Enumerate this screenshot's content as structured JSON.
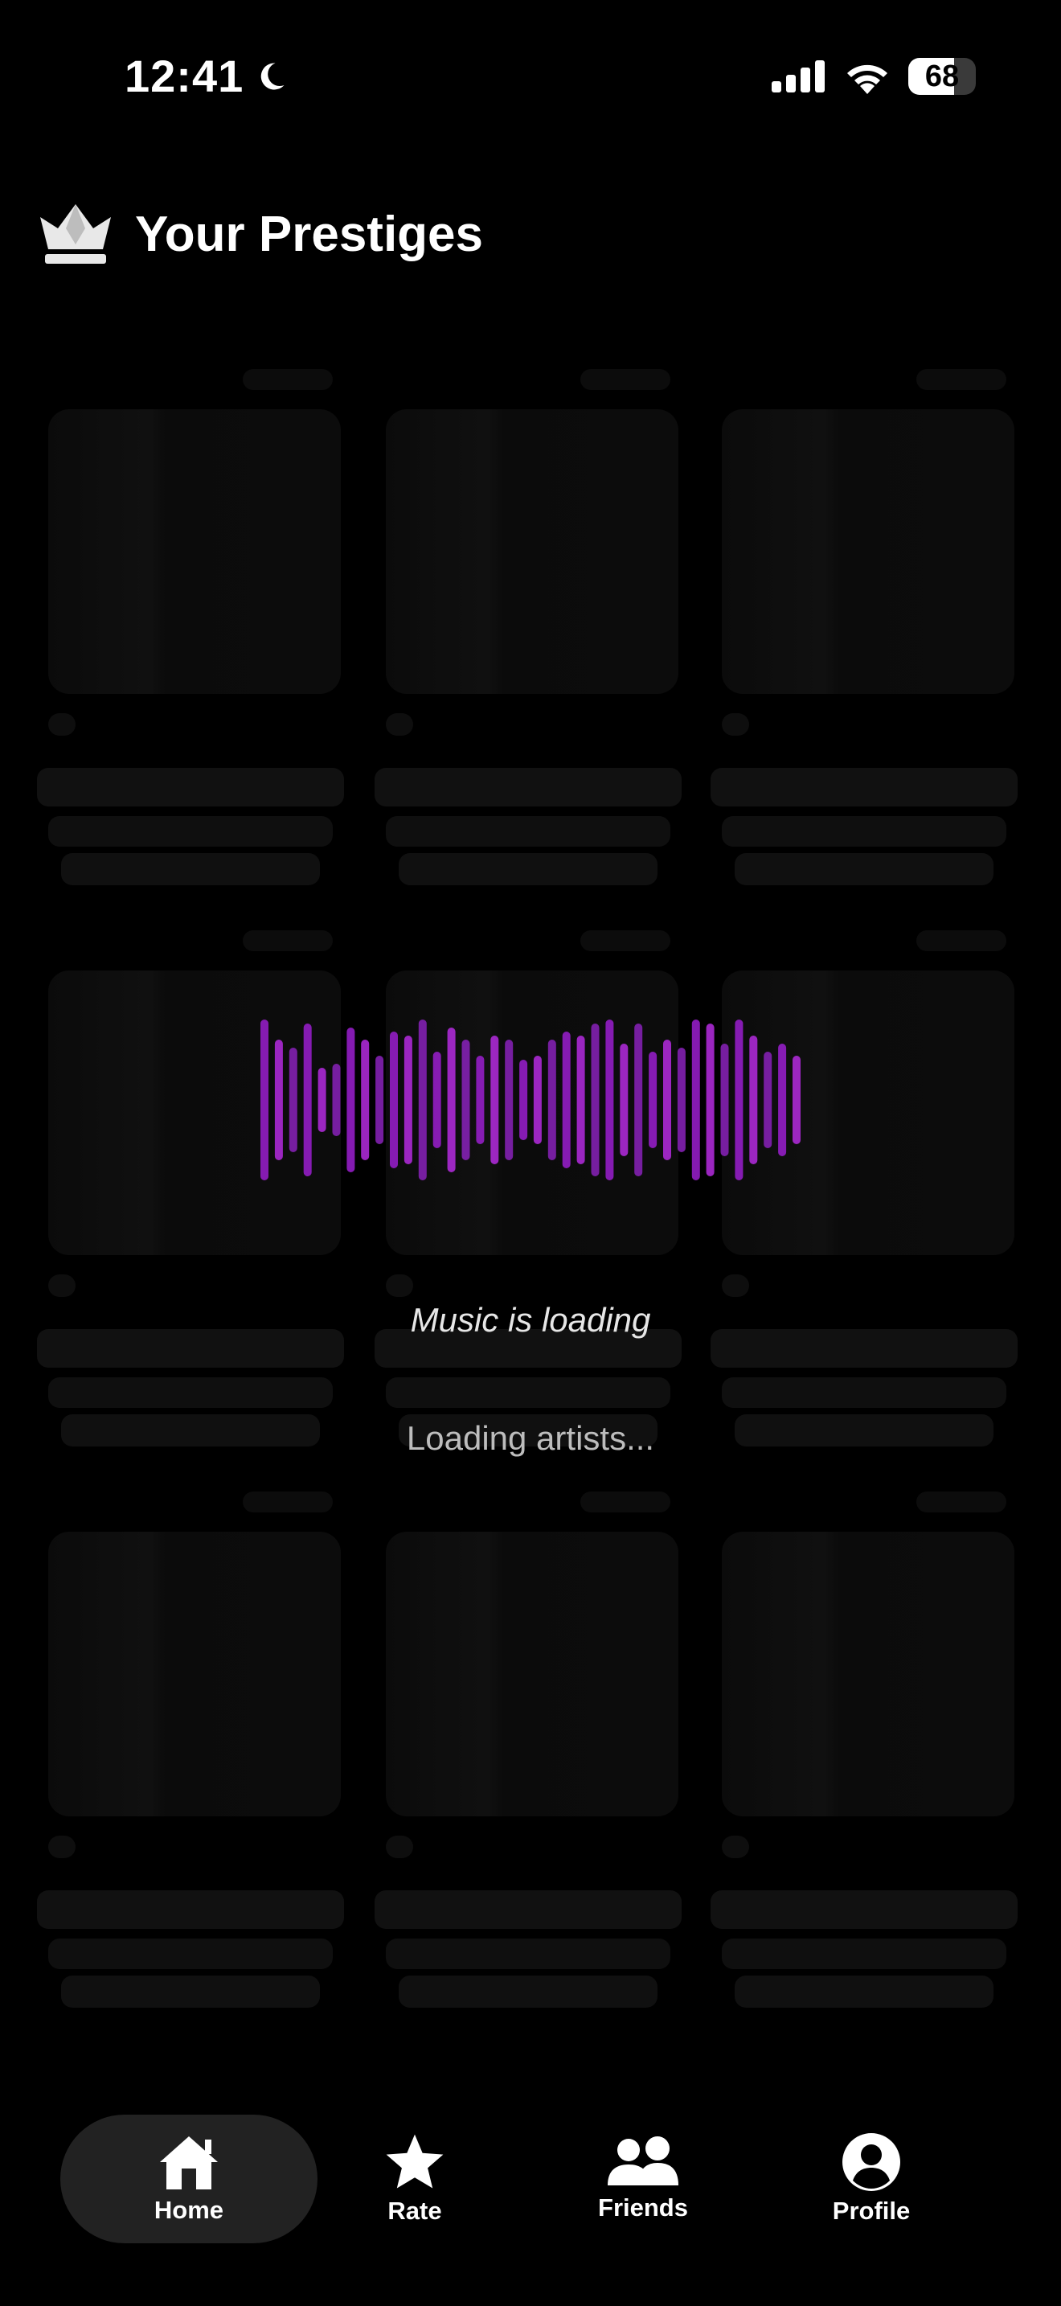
{
  "status_bar": {
    "time": "12:41",
    "battery": "68"
  },
  "header": {
    "title": "Your Prestiges"
  },
  "loader": {
    "title": "Music is loading",
    "subtitle": "Loading artists..."
  },
  "tabs": [
    {
      "label": "Home",
      "icon": "house-icon",
      "active": true
    },
    {
      "label": "Rate",
      "icon": "star-icon",
      "active": false
    },
    {
      "label": "Friends",
      "icon": "people-icon",
      "active": false
    },
    {
      "label": "Profile",
      "icon": "person-circle-icon",
      "active": false
    }
  ],
  "colors": {
    "accent": "#b52ce0",
    "background": "#000000",
    "active_tab": "#222222"
  }
}
